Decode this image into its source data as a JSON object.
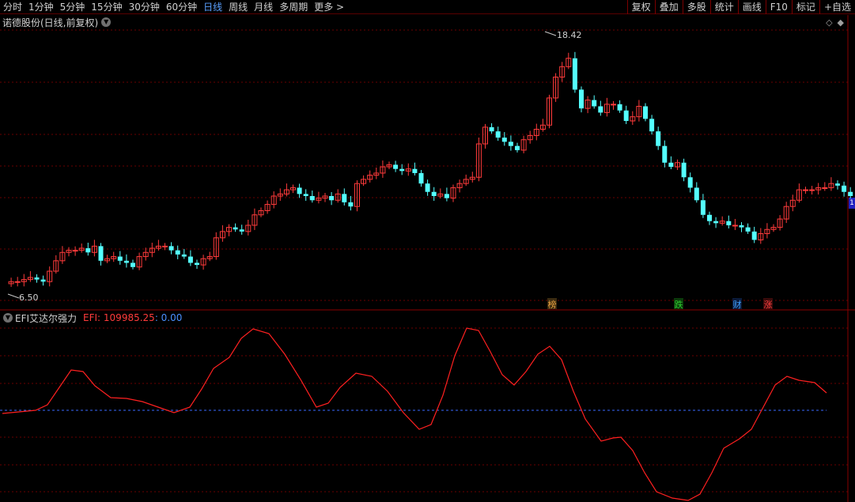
{
  "toolbar": {
    "periods": [
      {
        "label": "分时",
        "active": false
      },
      {
        "label": "1分钟",
        "active": false
      },
      {
        "label": "5分钟",
        "active": false
      },
      {
        "label": "15分钟",
        "active": false
      },
      {
        "label": "30分钟",
        "active": false
      },
      {
        "label": "60分钟",
        "active": false
      },
      {
        "label": "日线",
        "active": true
      },
      {
        "label": "周线",
        "active": false
      },
      {
        "label": "月线",
        "active": false
      },
      {
        "label": "多周期",
        "active": false
      },
      {
        "label": "更多",
        "active": false
      }
    ],
    "more_icon": "chevron-right-icon",
    "actions": [
      "复权",
      "叠加",
      "多股",
      "统计",
      "画线",
      "F10",
      "标记",
      "+自选"
    ]
  },
  "stock": {
    "title": "诺德股份(日线,前复权)",
    "dropdown_icon": "chevron-down-icon",
    "high_label": "18.42",
    "low_label": "6.50",
    "events": [
      {
        "label": "榜",
        "color": "#e8a040",
        "bg": "#3a2a10"
      },
      {
        "label": "跌",
        "color": "#30d030",
        "bg": "#0a3a0a"
      },
      {
        "label": "财",
        "color": "#40a0ff",
        "bg": "#0a1a3a"
      },
      {
        "label": "涨",
        "color": "#ff4040",
        "bg": "#3a0a0a"
      }
    ],
    "right_marker": "1"
  },
  "indicator": {
    "name": "EFI艾达尔强力",
    "value_text": "EFI: 109985.25",
    "value_text2": ": 0.00"
  },
  "colors": {
    "up": "#ff3b3b",
    "down": "#54ffff",
    "grid": "#6a0000",
    "efi_line": "#ff2020",
    "zero_line": "#3a6aff"
  },
  "chart_data": {
    "type": "candlestick",
    "high": 18.42,
    "low": 6.5,
    "efi_zero": 0.0,
    "efi_current": 109985.25
  }
}
